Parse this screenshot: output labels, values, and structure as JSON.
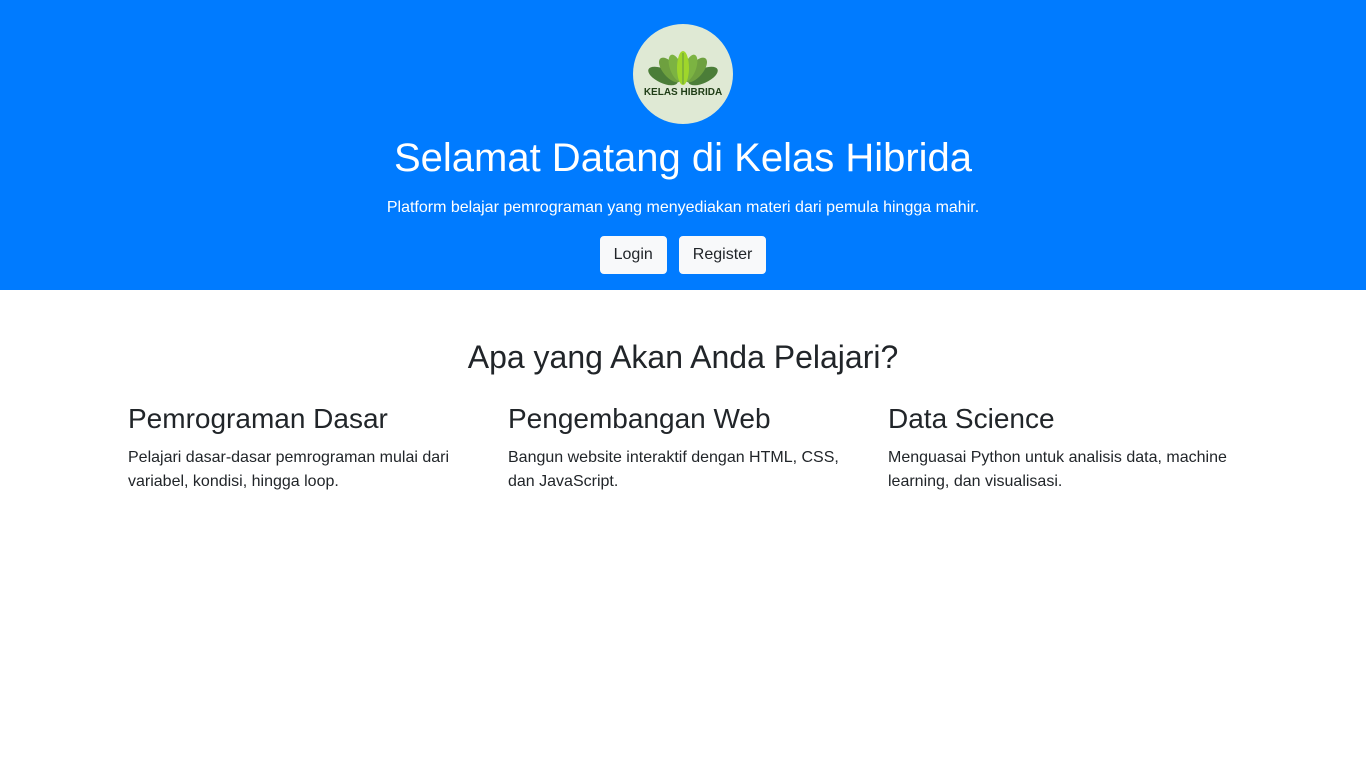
{
  "hero": {
    "logo_text": "KELAS HIBRIDA",
    "title": "Selamat Datang di Kelas Hibrida",
    "subtitle": "Platform belajar pemrograman yang menyediakan materi dari pemula hingga mahir.",
    "login_label": "Login",
    "register_label": "Register",
    "bg_color": "#007bff"
  },
  "main": {
    "section_title": "Apa yang Akan Anda Pelajari?",
    "features": [
      {
        "title": "Pemrograman Dasar",
        "description": "Pelajari dasar-dasar pemrograman mulai dari variabel, kondisi, hingga loop."
      },
      {
        "title": "Pengembangan Web",
        "description": "Bangun website interaktif dengan HTML, CSS, dan JavaScript."
      },
      {
        "title": "Data Science",
        "description": "Menguasai Python untuk analisis data, machine learning, dan visualisasi."
      }
    ]
  }
}
